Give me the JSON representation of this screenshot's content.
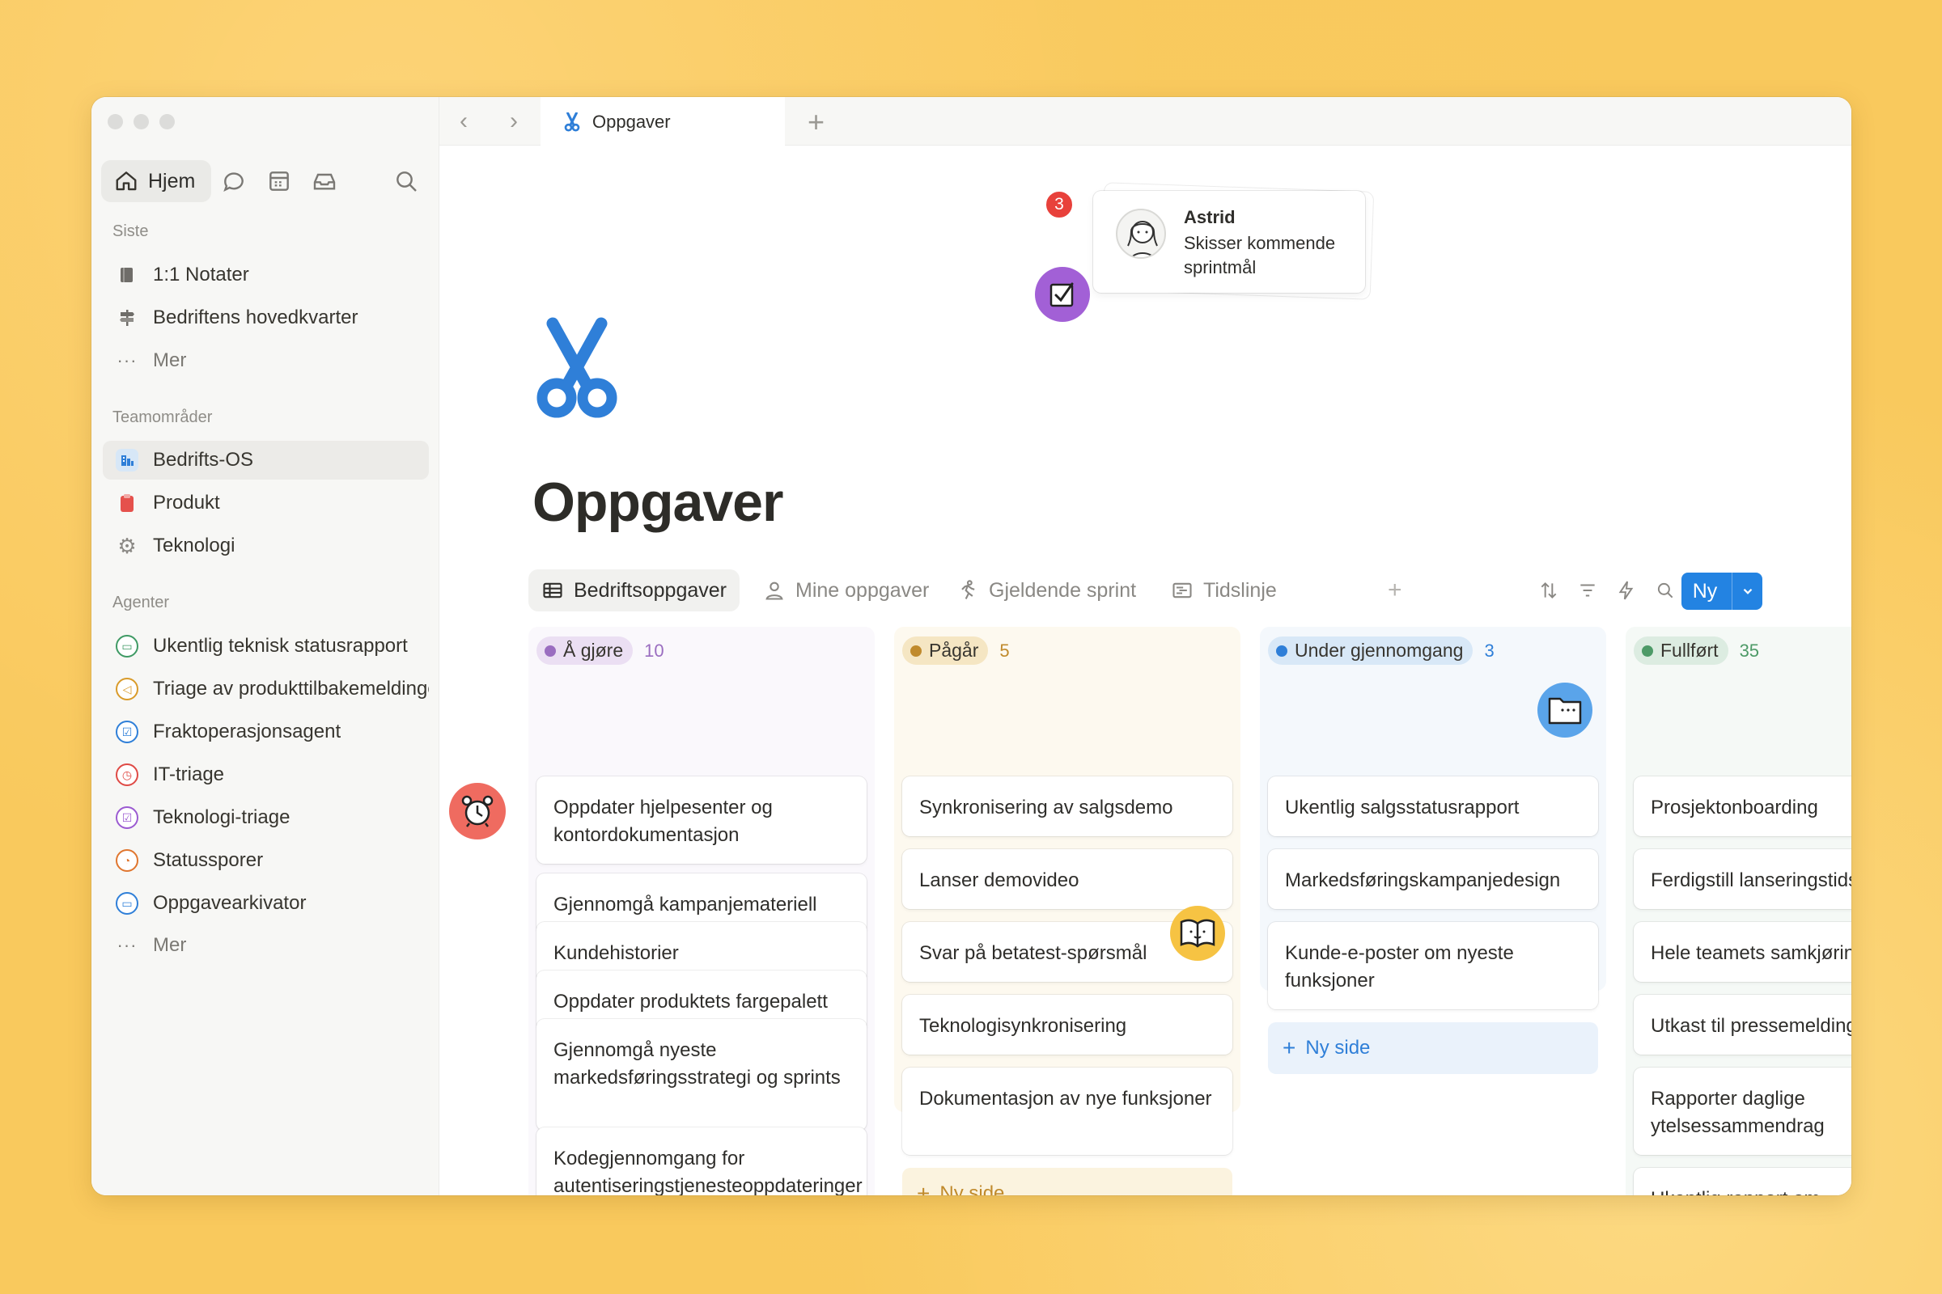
{
  "tab": {
    "title": "Oppgaver"
  },
  "sidebar": {
    "home_label": "Hjem",
    "recent_title": "Siste",
    "recent": [
      {
        "label": "1:1 Notater",
        "icon": "document-icon"
      },
      {
        "label": "Bedriftens hovedkvarter",
        "icon": "signpost-icon"
      },
      {
        "label": "Mer",
        "icon": "more-icon"
      }
    ],
    "teams_title": "Teamområder",
    "teams": [
      {
        "label": "Bedrifts-OS",
        "icon": "building-icon"
      },
      {
        "label": "Produkt",
        "icon": "clipboard-icon"
      },
      {
        "label": "Teknologi",
        "icon": "gear-icon"
      }
    ],
    "agents_title": "Agenter",
    "agents": [
      {
        "label": "Ukentlig teknisk statusrapport",
        "color": "#3f9a64"
      },
      {
        "label": "Triage av produkttilbakemeldinger",
        "color": "#d99b2a"
      },
      {
        "label": "Fraktoperasjonsagent",
        "color": "#2f7fd8"
      },
      {
        "label": "IT-triage",
        "color": "#df4a45"
      },
      {
        "label": "Teknologi-triage",
        "color": "#9b5ad1"
      },
      {
        "label": "Statussporer",
        "color": "#e0762f"
      },
      {
        "label": "Oppgavearkivator",
        "color": "#2f7fd8"
      }
    ],
    "agents_more": "Mer"
  },
  "page": {
    "title": "Oppgaver"
  },
  "views": [
    {
      "label": "Bedriftsoppgaver",
      "icon": "table-icon"
    },
    {
      "label": "Mine oppgaver",
      "icon": "person-icon"
    },
    {
      "label": "Gjeldende sprint",
      "icon": "runner-icon"
    },
    {
      "label": "Tidslinje",
      "icon": "timeline-icon"
    }
  ],
  "new_button": "Ny",
  "notification": {
    "count": "3",
    "name": "Astrid",
    "text": "Skisser kommende sprintmål"
  },
  "columns": [
    {
      "status": "Å gjøre",
      "count": "10",
      "colors": {
        "bg": "#faf8fc",
        "pill": "#ebdff3",
        "dot": "#9a6dc0",
        "count": "#9a6dc0"
      },
      "cards": [
        "Oppdater hjelpesenter og kontordokumentasjon",
        "Gjennomgå kampanjemateriell",
        "Kundehistorier",
        "Oppdater produktets fargepalett",
        "Gjennomgå nyeste markedsføringsstrategi og sprints",
        "Kodegjennomgang for autentiseringstjenesteoppdateringer"
      ]
    },
    {
      "status": "Pågår",
      "count": "5",
      "colors": {
        "bg": "#fdf9ef",
        "pill": "#f5e6c3",
        "dot": "#c08a2c",
        "count": "#c08a2c"
      },
      "cards": [
        "Synkronisering av salgsdemo",
        "Lanser demovideo",
        "Svar på betatest-spørsmål",
        "Teknologisynkronisering",
        "Dokumentasjon av nye funksjoner"
      ],
      "new_page": "Ny side"
    },
    {
      "status": "Under gjennomgang",
      "count": "3",
      "colors": {
        "bg": "#f4f8fc",
        "pill": "#d8e8f7",
        "dot": "#2f7fd8",
        "count": "#2f7fd8"
      },
      "cards": [
        "Ukentlig salgsstatusrapport",
        "Markedsføringskampanjedesign",
        "Kunde-e-poster om nyeste funksjoner"
      ],
      "new_page": "Ny side"
    },
    {
      "status": "Fullført",
      "count": "35",
      "colors": {
        "bg": "#f5f9f6",
        "pill": "#dcece1",
        "dot": "#4d9a67",
        "count": "#4d9a67"
      },
      "cards": [
        "Prosjektonboarding",
        "Ferdigstill lanseringstidslinje",
        "Hele teamets samkjøring",
        "Utkast til pressemelding",
        "Rapporter daglige ytelsessammendrag",
        "Ukentlig rapport om produktlansering"
      ]
    }
  ]
}
